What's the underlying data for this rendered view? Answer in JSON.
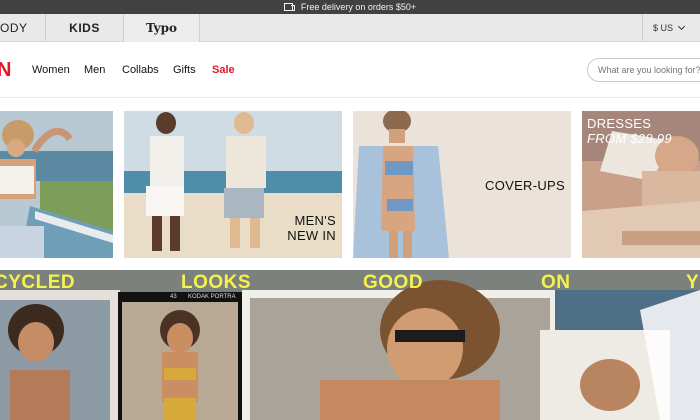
{
  "promo": {
    "text": "Free delivery on orders $50+"
  },
  "brand_tabs": [
    "ODY",
    "KIDS",
    "Typo"
  ],
  "currency": {
    "label": "$ US"
  },
  "logo": {
    "text": "N"
  },
  "nav": {
    "links": [
      "Women",
      "Men",
      "Collabs",
      "Gifts",
      "Sale"
    ],
    "sale_color": "#e3172a"
  },
  "search": {
    "placeholder": "What are you looking for?"
  },
  "tiles": [
    {
      "label": ""
    },
    {
      "label_line1": "MEN'S",
      "label_line2": "NEW IN"
    },
    {
      "label": "COVER-UPS"
    },
    {
      "label_line1": "DRESSES",
      "label_line2": "FROM $29.99"
    }
  ],
  "hero": {
    "words": [
      "CYCLED",
      "LOOKS",
      "GOOD",
      "ON",
      "Y"
    ],
    "film_labels": [
      "43",
      "KODAK PORTRA"
    ],
    "word_color": "#f6f24d"
  },
  "colors": {
    "brand_red": "#e3172a",
    "promo_bg": "#414141",
    "tabs_bg": "#e9e9e9"
  }
}
